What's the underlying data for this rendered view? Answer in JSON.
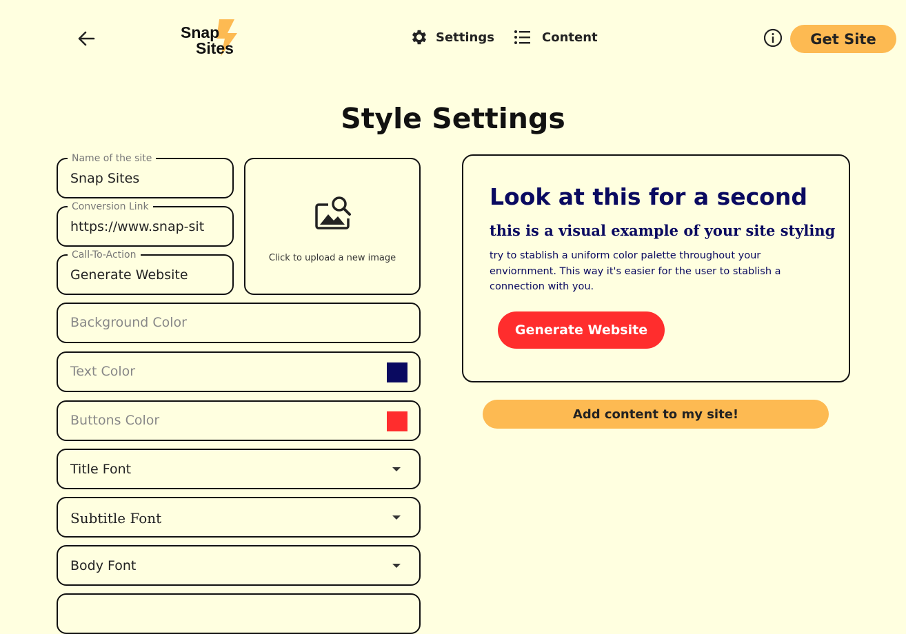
{
  "header": {
    "logo_text_line1": "Snap",
    "logo_text_line2": "Sites",
    "back_icon": "arrow-left-icon",
    "nav": [
      {
        "label": "Settings",
        "icon": "gear-icon"
      },
      {
        "label": "Content",
        "icon": "list-icon"
      }
    ],
    "info_icon": "info-icon",
    "get_site_label": "Get Site"
  },
  "page_title": "Style Settings",
  "form": {
    "site_name": {
      "label": "Name of the site",
      "value": "Snap Sites"
    },
    "conversion_link": {
      "label": "Conversion Link",
      "value": "https://www.snap-sit"
    },
    "cta": {
      "label": "Call-To-Action",
      "value": "Generate Website"
    },
    "upload": {
      "text": "Click to upload a new image",
      "icon": "image-search-icon"
    },
    "colors": [
      {
        "label": "Background Color",
        "value": "#FFFFE0"
      },
      {
        "label": "Text Color",
        "value": "#0A0A60"
      },
      {
        "label": "Buttons Color",
        "value": "#FF2D2D"
      }
    ],
    "fonts": [
      {
        "label": "Title Font"
      },
      {
        "label": "Subtitle Font"
      },
      {
        "label": "Body Font"
      }
    ]
  },
  "preview": {
    "title": "Look at this for a second",
    "subtitle": "this is a visual example of your site styling",
    "body": "try to stablish a uniform color palette throughout your enviornment. This way it's easier for the user to stablish a connection with you.",
    "button_label": "Generate Website"
  },
  "add_content_label": "Add content to my site!",
  "colors": {
    "background": "#FFFFE0",
    "accent": "#FDBA52",
    "text": "#0A0A60",
    "button": "#FF2D2D"
  }
}
